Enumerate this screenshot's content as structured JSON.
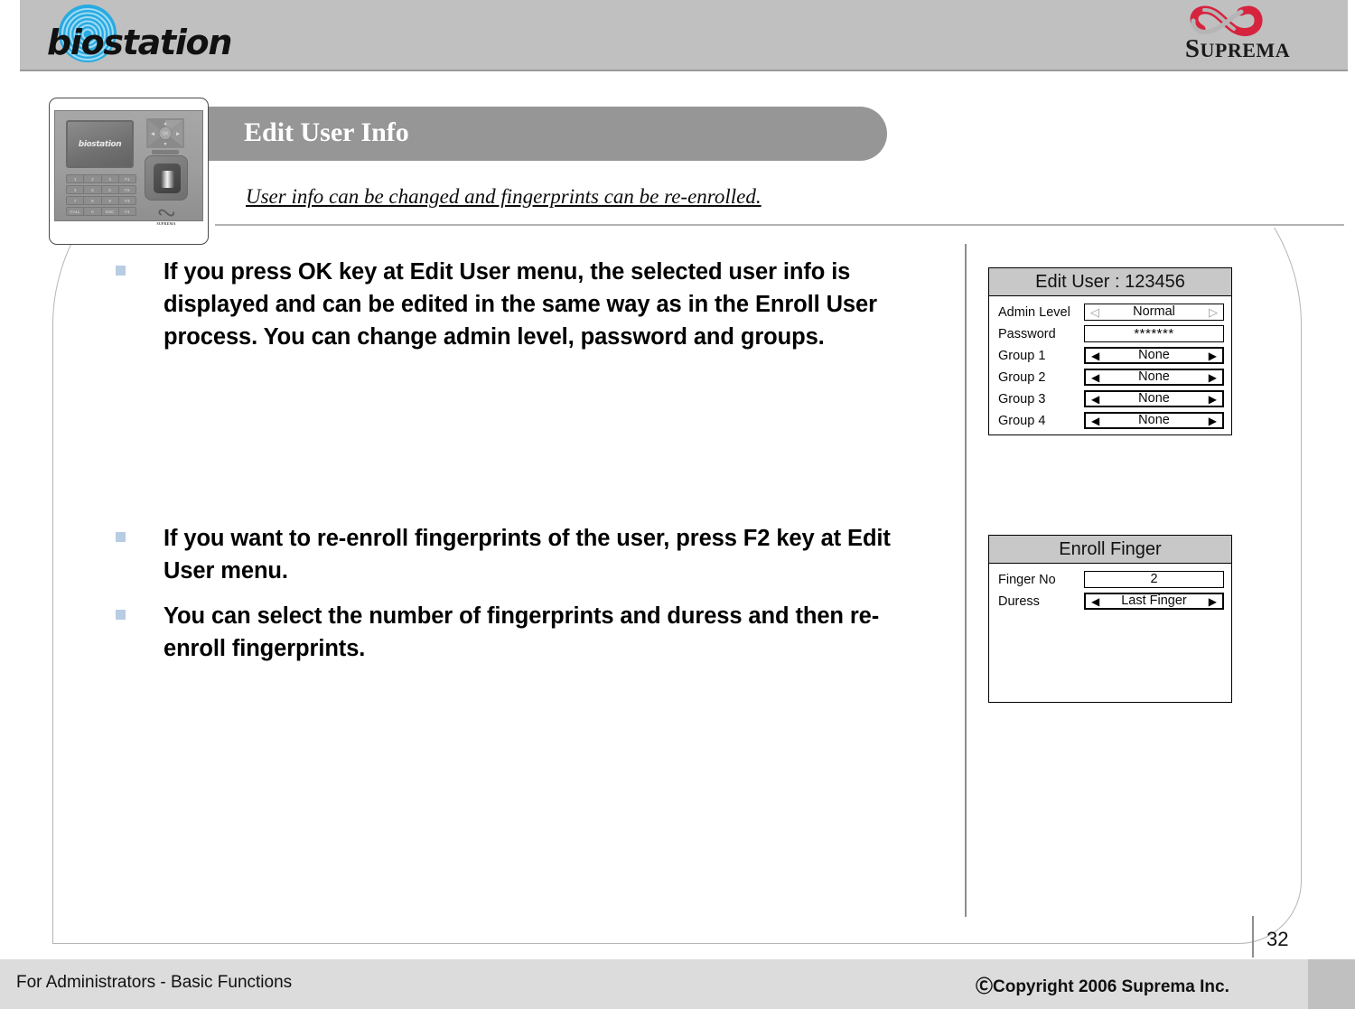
{
  "header": {
    "brand_logo_text": "biostation",
    "company_logo_text": "SUPREMA",
    "company_logo_initial": "S",
    "company_logo_rest": "UPREMA",
    "header_bg": "#c0c0c0",
    "swirl_color": "#29aae1"
  },
  "device": {
    "name": "biostation-terminal",
    "lcd_text": "biostation",
    "brand_mark": "SUPREMA",
    "keypad_rows": [
      [
        "1",
        "2",
        "3",
        "F1"
      ],
      [
        "4",
        "5",
        "6",
        "F2"
      ],
      [
        "7",
        "8",
        "9",
        "F3"
      ],
      [
        "CALL",
        "0",
        "ESC",
        "F4"
      ]
    ]
  },
  "slide": {
    "title": "Edit User Info",
    "subtitle": "User info can be changed and fingerprints can be re-enrolled.",
    "title_bar_color": "#969696",
    "bullets_group_1": [
      "If you press OK key at Edit User menu, the selected user info is displayed and can be edited in the same way as in the Enroll User process. You can change admin level, password and groups."
    ],
    "bullets_group_2": [
      "If you want to re-enroll fingerprints of the user, press F2 key at Edit User menu.",
      "You can select the number of fingerprints and duress and then re-enroll fingerprints."
    ],
    "bullet_marker_color": "#b8cce4"
  },
  "panels": [
    {
      "id": "edit-user",
      "title": "Edit User : 123456",
      "title_bg": "#c8c8c8",
      "rows": [
        {
          "label": "Admin Level",
          "value": "Normal",
          "left_arrow": "◁",
          "right_arrow": "▷",
          "arrow_style": "hollow",
          "border": "thin"
        },
        {
          "label": "Password",
          "value": "*******",
          "left_arrow": "",
          "right_arrow": "",
          "arrow_style": "none",
          "border": "thin"
        },
        {
          "label": "Group 1",
          "value": "None",
          "left_arrow": "◀",
          "right_arrow": "▶",
          "arrow_style": "solid",
          "border": "thick"
        },
        {
          "label": "Group 2",
          "value": "None",
          "left_arrow": "◀",
          "right_arrow": "▶",
          "arrow_style": "solid",
          "border": "thick"
        },
        {
          "label": "Group 3",
          "value": "None",
          "left_arrow": "◀",
          "right_arrow": "▶",
          "arrow_style": "solid",
          "border": "thick"
        },
        {
          "label": "Group 4",
          "value": "None",
          "left_arrow": "◀",
          "right_arrow": "▶",
          "arrow_style": "solid",
          "border": "thick"
        }
      ]
    },
    {
      "id": "enroll-finger",
      "title": "Enroll Finger",
      "title_bg": "#c8c8c8",
      "rows": [
        {
          "label": "Finger No",
          "value": "2",
          "left_arrow": "",
          "right_arrow": "",
          "arrow_style": "none",
          "border": "thin"
        },
        {
          "label": "Duress",
          "value": "Last Finger",
          "left_arrow": "◀",
          "right_arrow": "▶",
          "arrow_style": "solid",
          "border": "thick"
        }
      ]
    }
  ],
  "footer": {
    "left_text": "For Administrators - Basic Functions",
    "right_text": "ⒸCopyright 2006 Suprema Inc.",
    "page_number": "32",
    "bg": "#dcdcdc"
  }
}
